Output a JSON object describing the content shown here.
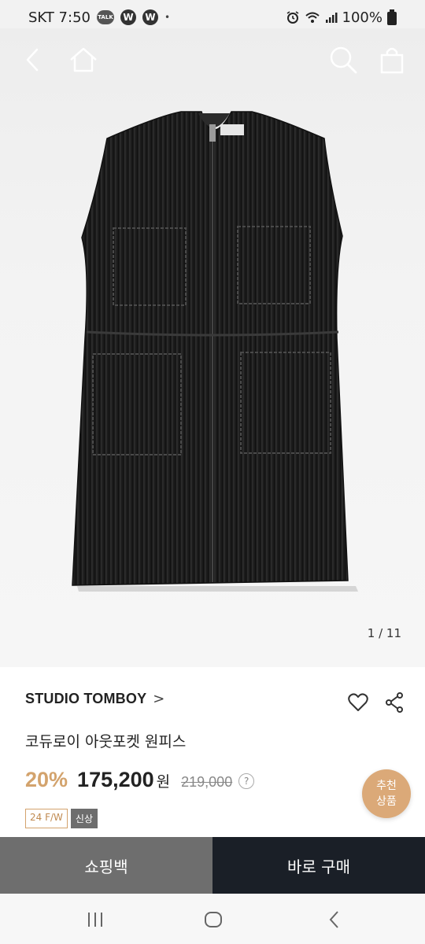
{
  "status_bar": {
    "carrier_time": "SKT 7:50",
    "talk_badge": "TALK",
    "w_badge_1": "W",
    "w_badge_2": "W",
    "dot": "•",
    "battery": "100%"
  },
  "top_nav": {
    "icons": [
      "back-icon",
      "home-icon",
      "search-icon",
      "shopping-bag-icon"
    ]
  },
  "product_image": {
    "page_indicator": "1 / 11"
  },
  "product": {
    "brand": "STUDIO TOMBOY",
    "brand_chevron": ">",
    "name": "코듀로이 아웃포켓 원피스",
    "discount": "20%",
    "price": "175,200",
    "currency": "원",
    "original_price": "219,000",
    "help_mark": "?",
    "tags": [
      "24 F/W",
      "신상"
    ],
    "recommend_line1": "추천",
    "recommend_line2": "상품"
  },
  "actions": {
    "cart_label": "쇼핑백",
    "buy_label": "바로 구매"
  },
  "system_nav": {
    "icons": [
      "recents-icon",
      "home-circle-icon",
      "back-chevron-icon"
    ]
  },
  "colors": {
    "accent": "#d3a36d",
    "buy_bg": "#1a1f27",
    "cart_bg": "#6e6e6e",
    "recommend_bg": "#dba978"
  }
}
